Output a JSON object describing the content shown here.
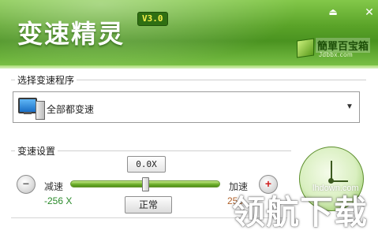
{
  "header": {
    "title": "变速精灵",
    "version": "V3.0",
    "logo": {
      "name": "簡單百宝箱",
      "subtitle": "Jdbbx.com"
    },
    "accent_color": "#5aa328"
  },
  "window_controls": {
    "minimize_icon": "minimize-icon",
    "close_icon": "close-icon"
  },
  "program_section": {
    "title": "选择变速程序",
    "selected": "全部都变速",
    "icon": "computer-icon"
  },
  "speed_section": {
    "title": "变速设置",
    "speed_display": "0.0X",
    "slow_label": "减速",
    "fast_label": "加速",
    "min_value": "-256 X",
    "max_value": "256",
    "normal_button": "正常",
    "slider_position": 0.5,
    "min_icon": "minus-icon",
    "plus_icon": "plus-icon"
  },
  "watermark": {
    "text": "领航下载",
    "url": "lhdown.com"
  }
}
